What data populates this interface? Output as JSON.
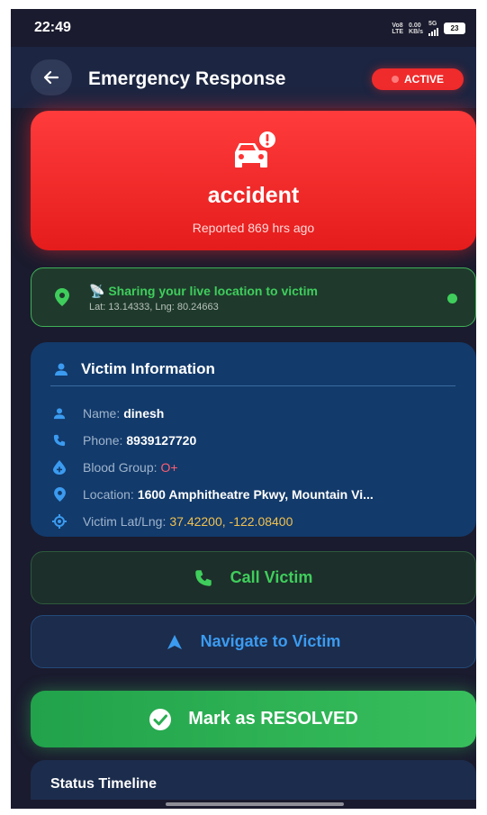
{
  "status_bar": {
    "time": "22:49",
    "network_top": "Vo8",
    "network_bottom": "LTE",
    "speed_value": "0.00",
    "speed_unit": "KB/s",
    "signal_label": "5G",
    "battery": "23"
  },
  "header": {
    "title": "Emergency Response",
    "badge": "ACTIVE",
    "back_icon": "arrow-left-icon"
  },
  "emergency": {
    "type": "accident",
    "reported": "Reported 869 hrs ago",
    "icon": "car-crash-icon",
    "color": "#ff2a2a"
  },
  "location_sharing": {
    "title": "📡 Sharing your live location to victim",
    "coords": "Lat: 13.14333, Lng: 80.24663",
    "color": "#3fce5c"
  },
  "victim": {
    "header": "Victim Information",
    "name_label": "Name:",
    "name": "dinesh",
    "phone_label": "Phone:",
    "phone": "8939127720",
    "blood_label": "Blood Group:",
    "blood": "O+",
    "location_label": "Location:",
    "location": "1600 Amphitheatre Pkwy, Mountain Vi...",
    "latlng_label": "Victim Lat/Lng:",
    "latlng": "37.42200, -122.08400"
  },
  "actions": {
    "call": "Call Victim",
    "navigate": "Navigate to Victim",
    "resolve": "Mark as RESOLVED"
  },
  "timeline": {
    "title": "Status Timeline"
  }
}
